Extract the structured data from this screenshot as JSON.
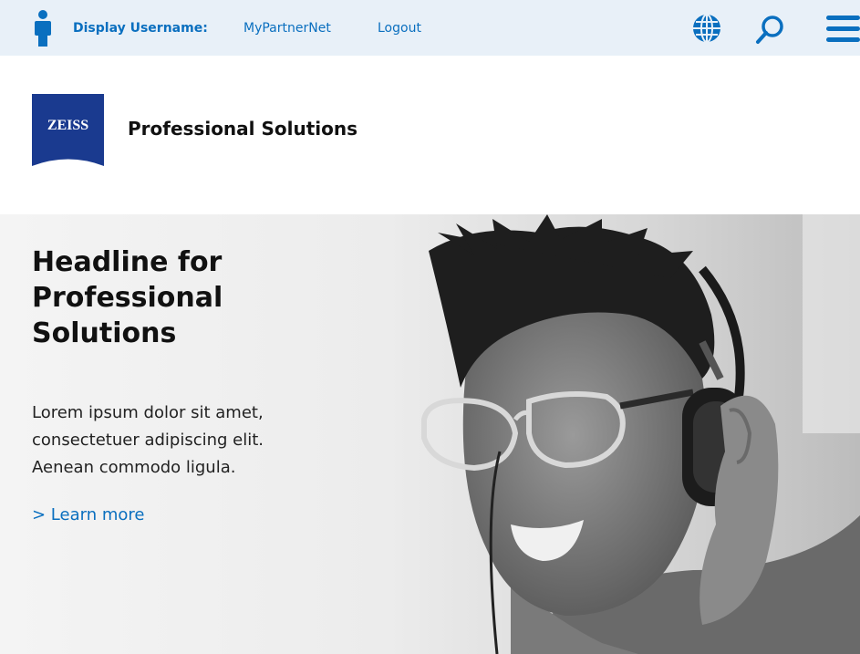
{
  "topbar": {
    "user_label": "Display Username:",
    "partner_link": "MyPartnerNet",
    "logout_link": "Logout",
    "icons": [
      "user-icon",
      "globe-icon",
      "search-icon",
      "menu-icon"
    ]
  },
  "header": {
    "logo_text": "ZEISS",
    "brand_title": "Professional Solutions"
  },
  "hero": {
    "headline": "Headline for\nProfessional\nSolutions",
    "body": "Lorem ipsum dolor sit amet,\nconsectetuer adipiscing elit.\nAenean commodo ligula.",
    "link": "> Learn more"
  },
  "colors": {
    "accent": "#0a6fbf",
    "topbar_bg": "#e8f0f8",
    "logo_bg": "#1a3a8f"
  }
}
